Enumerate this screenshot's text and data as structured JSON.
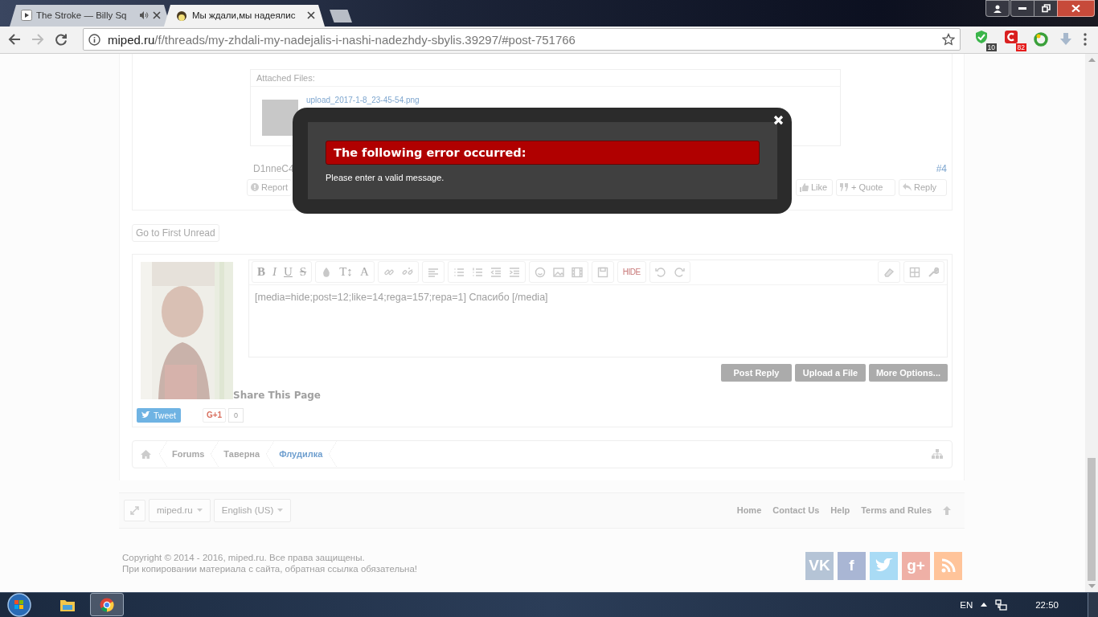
{
  "browser": {
    "tabs": [
      {
        "title": "The Stroke — Billy Sq",
        "selected": false,
        "audio": true
      },
      {
        "title": "Мы ждали,мы надеялис",
        "selected": true,
        "audio": false
      }
    ],
    "address": {
      "host": "miped.ru",
      "path": "/f/threads/my-zhdali-my-nadejalis-i-nashi-nadezhdy-sbylis.39297/#post-751766"
    },
    "extensions": [
      {
        "kind": "shield",
        "badge": "10",
        "color": "#444444"
      },
      {
        "kind": "c",
        "badge": "82",
        "color": "#e51c1c"
      }
    ]
  },
  "post": {
    "attachments_label": "Attached Files:",
    "file": "upload_2017-1-8_23-45-54.png",
    "author": "D1nneC4",
    "number": "#4",
    "actions_left": [
      "Report"
    ],
    "actions_right": [
      "Like",
      "+ Quote",
      "Reply"
    ]
  },
  "go_unread": "Go to First Unread",
  "editor": {
    "toolbar_text": [
      "B",
      "I",
      "U",
      "S",
      "T↕",
      "A",
      "HIDE"
    ],
    "value": "[media=hide;post=12;like=14;rega=157;repa=1] Спасибо [/media]",
    "buttons": [
      "Post Reply",
      "Upload a File",
      "More Options..."
    ]
  },
  "share": {
    "title": "Share This Page",
    "tweet": "Tweet",
    "gplus": "G+1",
    "gplus_count": "0"
  },
  "breadcrumb": [
    {
      "label": "Forums",
      "selected": false
    },
    {
      "label": "Таверна",
      "selected": false
    },
    {
      "label": "Флудилка",
      "selected": true
    }
  ],
  "footer": {
    "selectors": [
      "miped.ru",
      "English (US)"
    ],
    "links": [
      "Home",
      "Contact Us",
      "Help",
      "Terms and Rules"
    ]
  },
  "copyright": [
    "Copyright © 2014 - 2016, miped.ru. Все права защищены.",
    "При копировании материала с сайта, обратная ссылка обязательна!"
  ],
  "social": [
    {
      "kind": "text",
      "label": "VK",
      "color": "#b5c4d6"
    },
    {
      "kind": "text",
      "label": "f",
      "color": "#a9b6d4"
    },
    {
      "kind": "twitter",
      "color": "#a9dbf5"
    },
    {
      "kind": "text",
      "label": "g+",
      "color": "#efb0a6"
    },
    {
      "kind": "rss",
      "color": "#ffc49a"
    }
  ],
  "modal": {
    "title": "The following error occurred:",
    "message": "Please enter a valid message."
  },
  "taskbar": {
    "lang": "EN",
    "time": "22:50"
  }
}
